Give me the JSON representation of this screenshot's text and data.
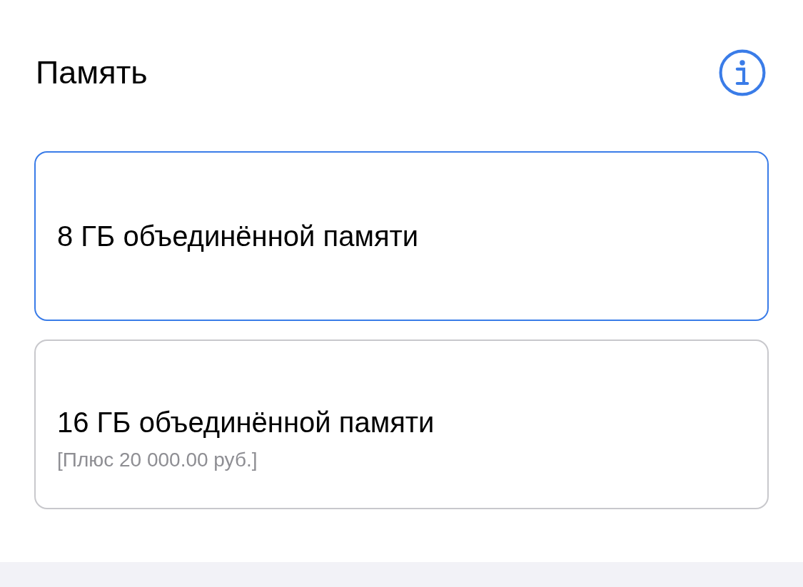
{
  "section": {
    "title": "Память"
  },
  "options": [
    {
      "label": "8 ГБ объединённой памяти",
      "selected": true
    },
    {
      "label": "16 ГБ объединённой памяти",
      "price": "[Плюс 20 000.00 руб.]",
      "selected": false
    }
  ]
}
